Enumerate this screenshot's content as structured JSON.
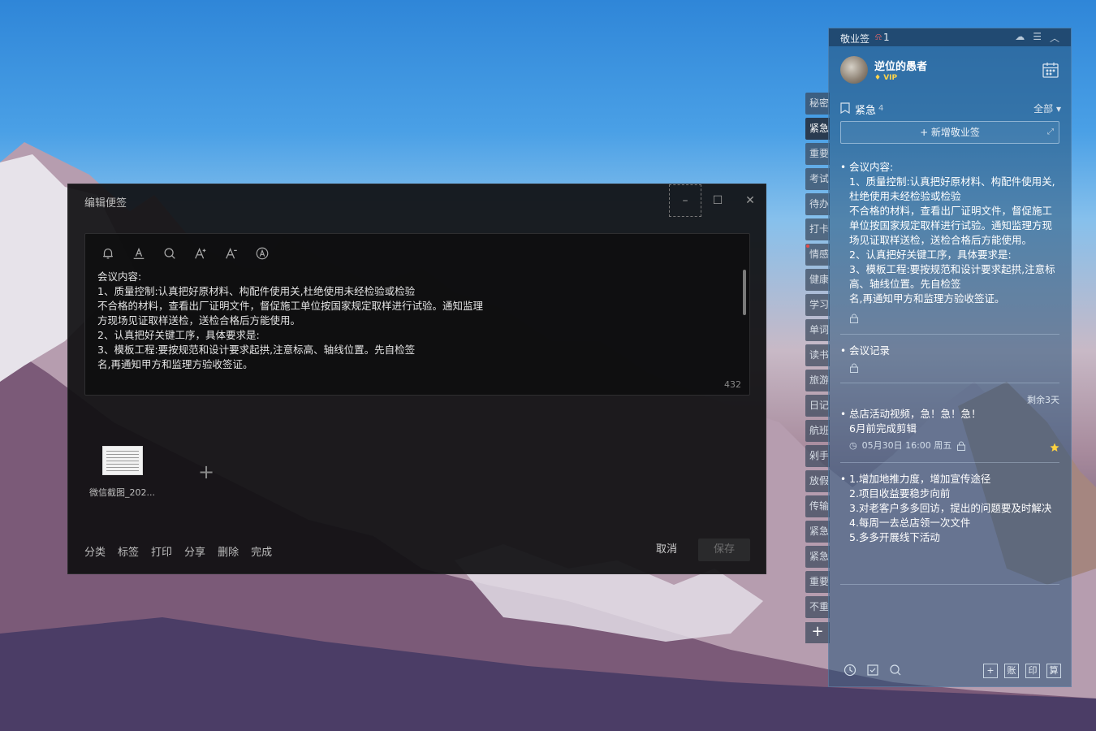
{
  "editor": {
    "title": "编辑便签",
    "window_controls": {
      "minimize": "–",
      "maximize": "☐",
      "close": "✕"
    },
    "toolbar_icons": [
      "bell-icon",
      "text-color-icon",
      "search-icon",
      "font-increase-icon",
      "font-decrease-icon",
      "text-style-icon"
    ],
    "content_lines": [
      "会议内容:",
      "1、质量控制:认真把好原材料、构配件使用关,杜绝使用未经检验或检验",
      "不合格的材料，查看出厂证明文件，督促施工单位按国家规定取样进行试验。通知监理",
      "方现场见证取样送检，送检合格后方能使用。",
      "2、认真把好关键工序，具体要求是:",
      "3、模板工程:要按规范和设计要求起拱,注意标高、轴线位置。先自检签",
      "名,再通知甲方和监理方验收签证。"
    ],
    "char_count": "432",
    "attachment": {
      "name": "微信截图_202..."
    },
    "add_attachment": "+",
    "actions": [
      "分类",
      "标签",
      "打印",
      "分享",
      "删除",
      "完成"
    ],
    "cancel_label": "取消",
    "save_label": "保存"
  },
  "side_tabs": [
    {
      "label": "秘密",
      "active": false
    },
    {
      "label": "紧急",
      "active": true
    },
    {
      "label": "重要",
      "active": false
    },
    {
      "label": "考试",
      "active": false
    },
    {
      "label": "待办",
      "active": false
    },
    {
      "label": "打卡",
      "active": false
    },
    {
      "label": "情感",
      "active": false,
      "dot": true
    },
    {
      "label": "健康",
      "active": false
    },
    {
      "label": "学习",
      "active": false
    },
    {
      "label": "单词",
      "active": false
    },
    {
      "label": "读书",
      "active": false
    },
    {
      "label": "旅游",
      "active": false
    },
    {
      "label": "日记",
      "active": false
    },
    {
      "label": "航班",
      "active": false
    },
    {
      "label": "剁手",
      "active": false
    },
    {
      "label": "放假",
      "active": false
    },
    {
      "label": "传输",
      "active": false
    },
    {
      "label": "紧急",
      "active": false
    },
    {
      "label": "紧急",
      "active": false
    },
    {
      "label": "重要",
      "active": false
    },
    {
      "label": "不重",
      "active": false
    }
  ],
  "side_tab_add": "+",
  "panel": {
    "app_name": "敬业签",
    "notification_count": "1",
    "user": {
      "name": "逆位的愚者",
      "badge": "VIP"
    },
    "category": {
      "name": "紧急",
      "count": "4",
      "filter": "全部"
    },
    "new_note_label": "+ 新增敬业签",
    "notes": [
      {
        "lines": [
          "会议内容:",
          "1、质量控制:认真把好原材料、构配件使用关,杜绝使用未经检验或检验",
          "不合格的材料，查看出厂证明文件，督促施工单位按国家规定取样进行试验。通知监理方现场见证取样送检，送检合格后方能使用。",
          "2、认真把好关键工序，具体要求是:",
          "3、模板工程:要按规范和设计要求起拱,注意标高、轴线位置。先自检签",
          "名,再通知甲方和监理方验收签证。"
        ]
      },
      {
        "lines": [
          "会议记录"
        ]
      },
      {
        "remaining": "剩余3天",
        "lines": [
          "总店活动视频，急！急！急！",
          "6月前完成剪辑"
        ],
        "reminder": "05月30日 16:00 周五"
      },
      {
        "lines": [
          "1.增加地推力度，增加宣传途径",
          "2.项目收益要稳步向前",
          "3.对老客户多多回访，提出的问题要及时解决",
          "4.每周一去总店领一次文件",
          "5.多多开展线下活动"
        ]
      }
    ],
    "bottom_boxes": [
      "+",
      "账",
      "印",
      "算"
    ]
  },
  "colors": {
    "panel_bg": "#265278",
    "accent_star": "#ffd23f",
    "vip": "#ffd54a"
  }
}
